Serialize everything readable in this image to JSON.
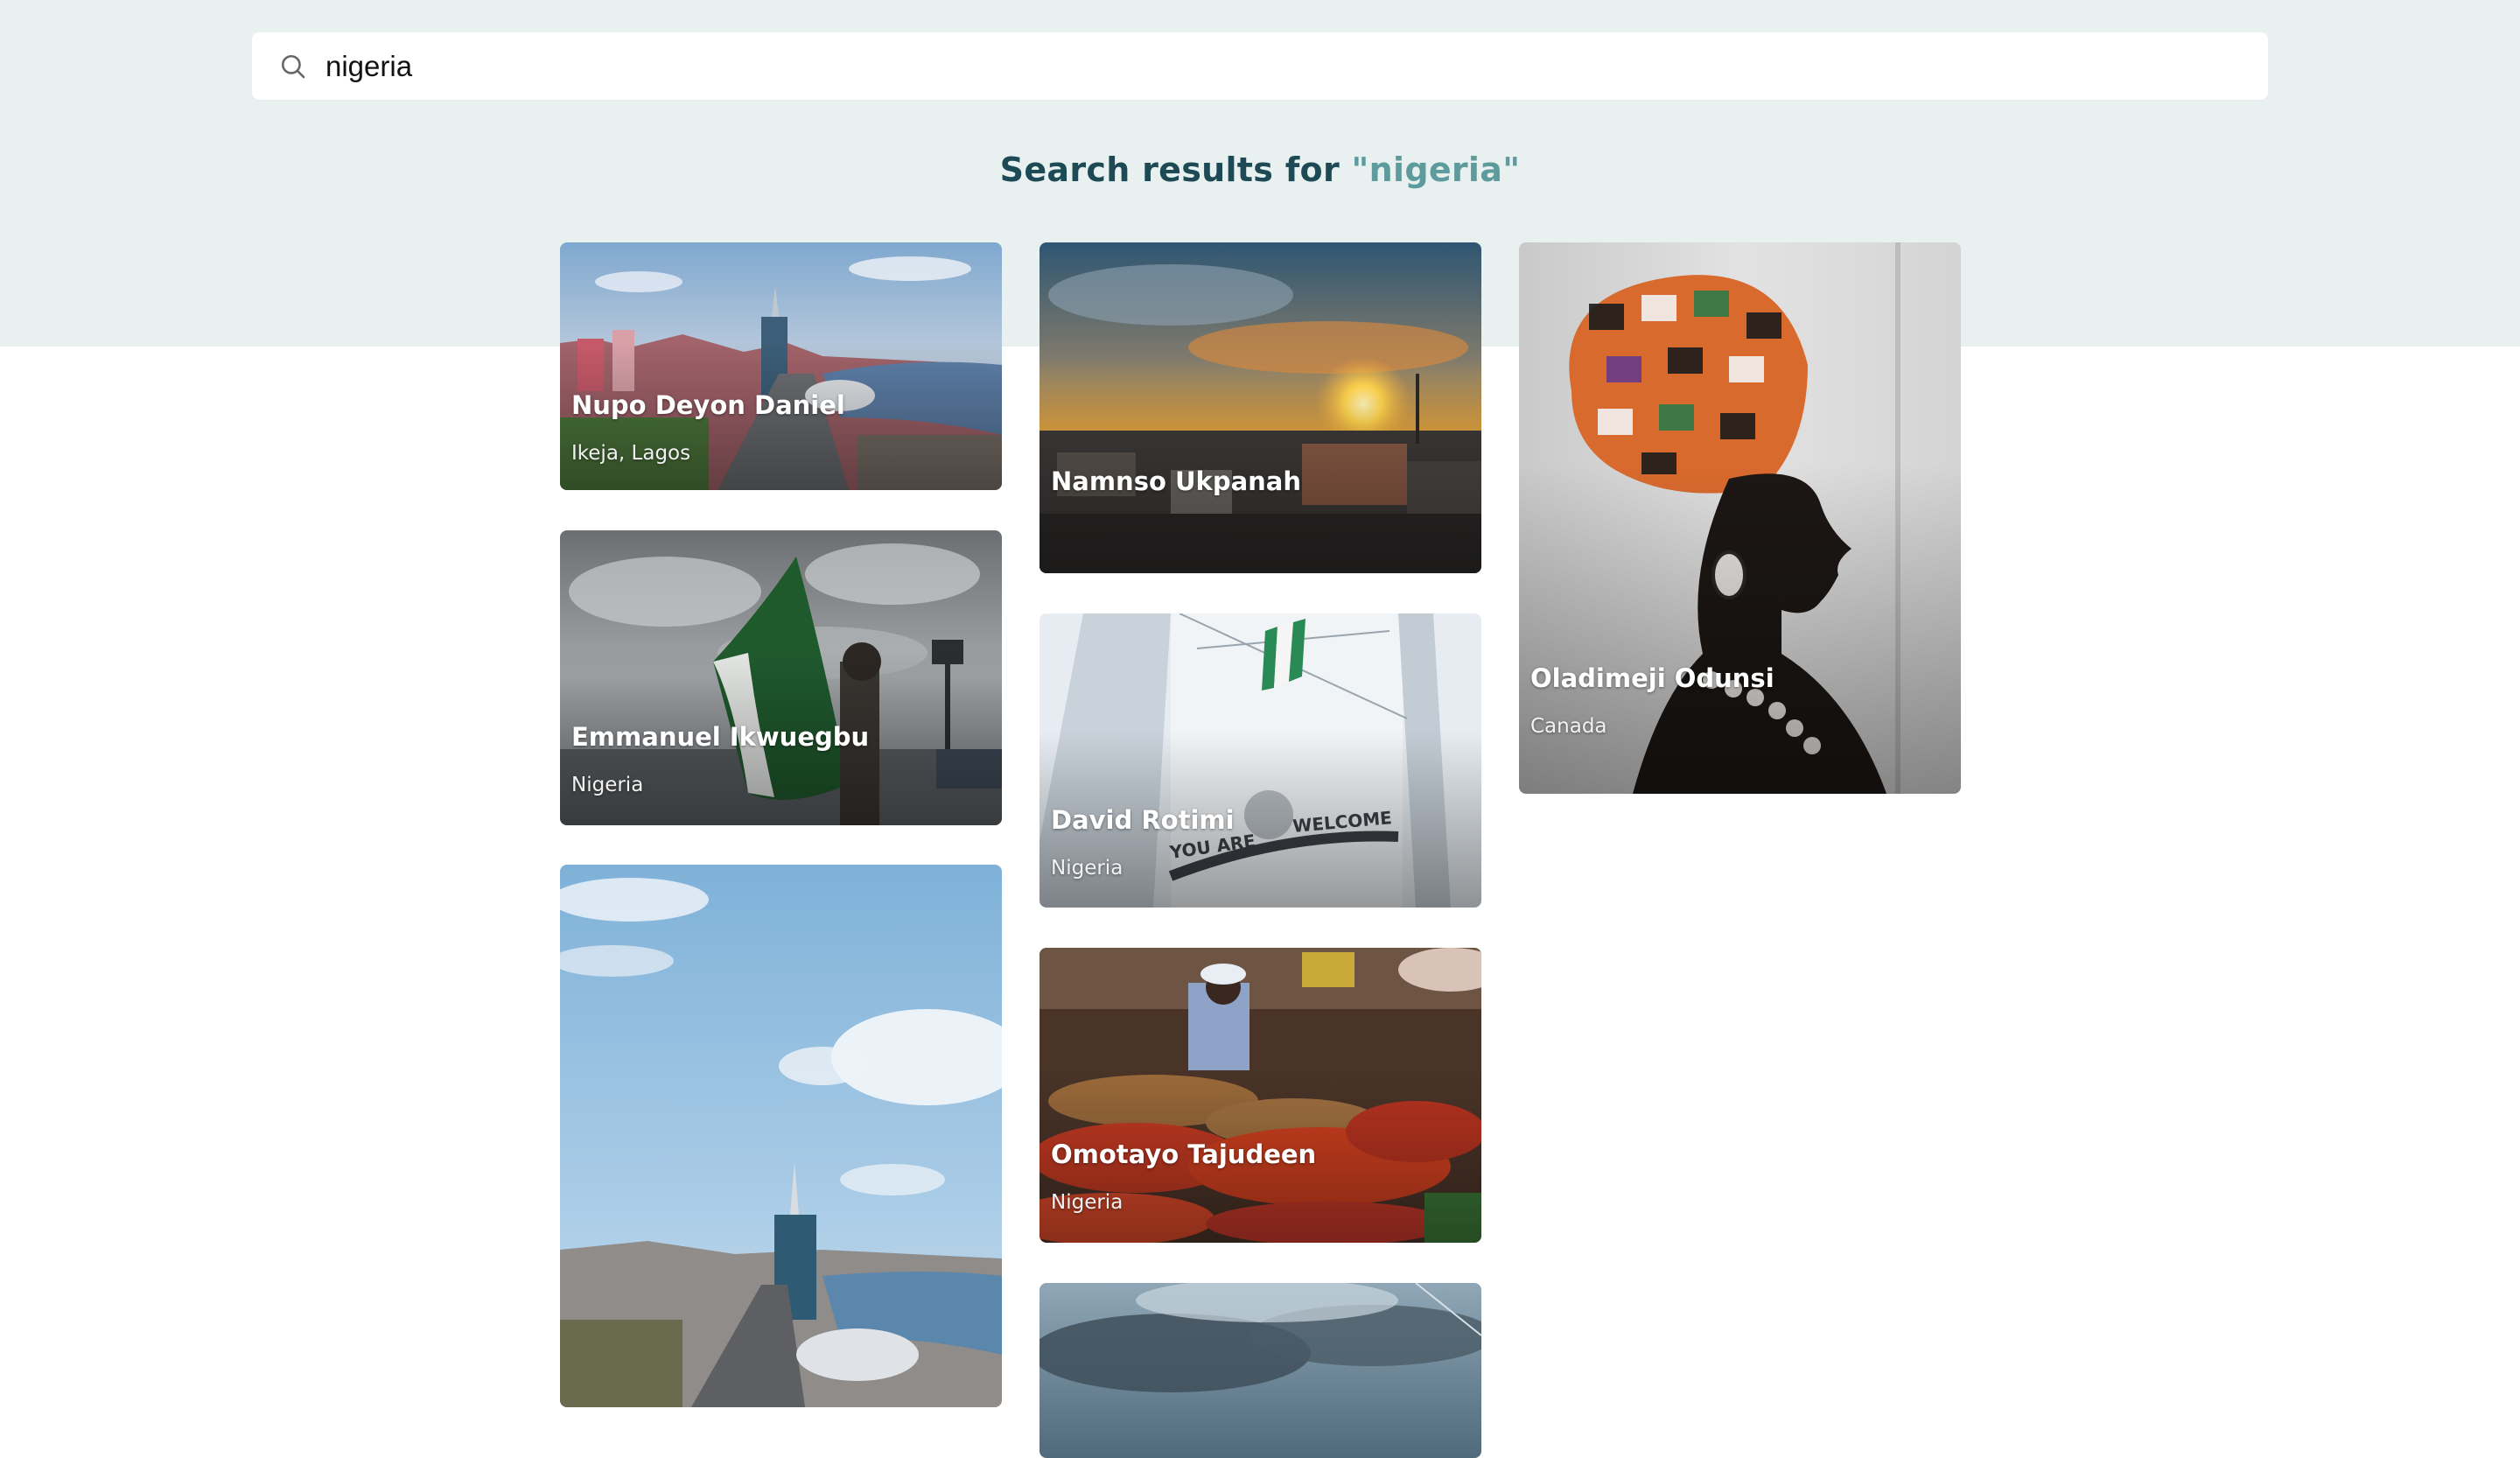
{
  "search": {
    "value": "nigeria",
    "placeholder": "Search"
  },
  "heading": {
    "prefix": "Search results for ",
    "query": "\"nigeria\""
  },
  "colors": {
    "band": "#e8f1f0",
    "heading": "#1d4a55",
    "query": "#5e9b9c"
  },
  "cards": [
    {
      "name": "Nupo Deyon Daniel",
      "place": "Ikeja, Lagos",
      "image": "lagos-skyline-aerial"
    },
    {
      "name": "Emmanuel Ikwuegbu",
      "place": "Nigeria",
      "image": "man-waving-nigerian-flag"
    },
    {
      "name": "",
      "place": "",
      "image": "lagos-tower-blue-sky"
    },
    {
      "name": "Namnso Ukpanah",
      "place": "",
      "image": "sunset-over-rooftops"
    },
    {
      "name": "David Rotimi",
      "place": "Nigeria",
      "image": "you-are-welcome-gate"
    },
    {
      "name": "Omotayo Tajudeen",
      "place": "Nigeria",
      "image": "tomato-market-vendor"
    },
    {
      "name": "",
      "place": "",
      "image": "cloudy-sky"
    },
    {
      "name": "Oladimeji Odunsi",
      "place": "Canada",
      "image": "woman-head-wrap-portrait"
    }
  ]
}
